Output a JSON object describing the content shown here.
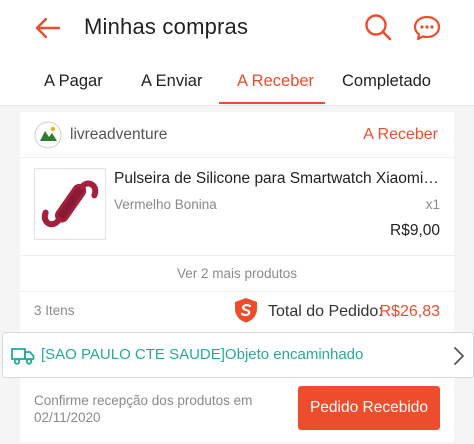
{
  "header": {
    "title": "Minhas compras",
    "back_icon": "arrow-left-icon",
    "search_icon": "search-icon",
    "chat_icon": "chat-icon",
    "accent_color": "#ee4d2d"
  },
  "tabs": [
    {
      "label": "A Pagar",
      "active": false
    },
    {
      "label": "A Enviar",
      "active": false
    },
    {
      "label": "A Receber",
      "active": true
    },
    {
      "label": "Completado",
      "active": false
    }
  ],
  "order": {
    "shop_name": "livreadventure",
    "status": "A Receber",
    "product": {
      "name": "Pulseira de Silicone para Smartwatch Xiaomi Mi Band",
      "variant": "Vermelho Bonina",
      "quantity": "x1",
      "price": "R$9,00"
    },
    "more_products": "Ver 2 mais produtos",
    "items_count": "3 Itens",
    "total_label": "Total do Pedido:",
    "total_value": "R$26,83",
    "shipping": {
      "icon": "truck-icon",
      "text": "[SAO PAULO CTE SAUDE]Objeto encaminhado",
      "color": "#26aa99"
    },
    "confirm_text": "Confirme recepção dos produtos em 02/11/2020",
    "receive_button": "Pedido Recebido"
  }
}
